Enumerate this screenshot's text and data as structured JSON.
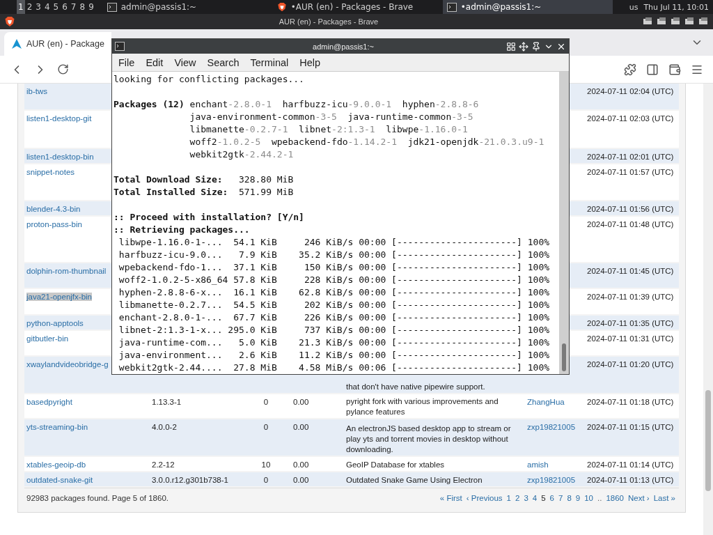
{
  "taskbar": {
    "workspaces": [
      {
        "label": "1",
        "selected": true
      },
      {
        "label": "2",
        "selected": false
      },
      {
        "label": "3",
        "selected": false
      },
      {
        "label": "4",
        "selected": false
      },
      {
        "label": "5",
        "selected": false
      },
      {
        "label": "6",
        "selected": false
      },
      {
        "label": "7",
        "selected": false
      },
      {
        "label": "8",
        "selected": false
      },
      {
        "label": "9",
        "selected": false
      }
    ],
    "windows": [
      {
        "kind": "terminal",
        "title": "admin@passis1:~",
        "selected": false
      },
      {
        "kind": "browser",
        "title": "•AUR (en) - Packages - Brave",
        "selected": false
      },
      {
        "kind": "terminal",
        "title": "•admin@passis1:~",
        "selected": true
      }
    ],
    "keyboard_layout": "us",
    "clock": "Thu Jul 11, 10:01"
  },
  "browser": {
    "window_title": "AUR (en) - Packages - Brave",
    "tab": {
      "title": "AUR (en) - Package"
    }
  },
  "packages_table": {
    "rows": [
      {
        "name": "ib-tws",
        "updated": "2024-07-11 02:04 (UTC)",
        "highlighted": false
      },
      {
        "name": "listen1-desktop-git",
        "updated": "2024-07-11 02:03 (UTC)",
        "highlighted": false
      },
      {
        "name": "listen1-desktop-bin",
        "updated": "2024-07-11 02:01 (UTC)",
        "highlighted": false
      },
      {
        "name": "snippet-notes",
        "updated": "2024-07-11 01:57 (UTC)",
        "highlighted": false
      },
      {
        "name": "blender-4.3-bin",
        "updated": "2024-07-11 01:56 (UTC)",
        "highlighted": false
      },
      {
        "name": "proton-pass-bin",
        "updated": "2024-07-11 01:48 (UTC)",
        "highlighted": false
      },
      {
        "name": "dolphin-rom-thumbnail",
        "updated": "2024-07-11 01:45 (UTC)",
        "highlighted": false
      },
      {
        "name": "java21-openjfx-bin",
        "updated": "2024-07-11 01:39 (UTC)",
        "highlighted": true
      },
      {
        "name": "python-apptools",
        "updated": "2024-07-11 01:35 (UTC)",
        "highlighted": false
      },
      {
        "name": "gitbutler-bin",
        "updated": "2024-07-11 01:31 (UTC)",
        "highlighted": false
      },
      {
        "name": "xwaylandvideobridge-g",
        "description": "that don't have native pipewire support.",
        "updated": "2024-07-11 01:20 (UTC)",
        "highlighted": false
      },
      {
        "name": "basedpyright",
        "version": "1.13.3-1",
        "votes": "0",
        "popularity": "0.00",
        "description": "pyright fork with various improvements and pylance features",
        "maintainer": "ZhangHua",
        "updated": "2024-07-11 01:18 (UTC)",
        "highlighted": false
      },
      {
        "name": "yts-streaming-bin",
        "version": "4.0.0-2",
        "votes": "0",
        "popularity": "0.00",
        "description": "An electronJS based desktop app to stream or play yts and torrent movies in desktop without downloading.",
        "maintainer": "zxp19821005",
        "updated": "2024-07-11 01:15 (UTC)",
        "highlighted": false
      },
      {
        "name": "xtables-geoip-db",
        "version": "2.2-12",
        "votes": "10",
        "popularity": "0.00",
        "description": "GeoIP Database for xtables",
        "maintainer": "amish",
        "updated": "2024-07-11 01:14 (UTC)",
        "highlighted": false
      },
      {
        "name": "outdated-snake-git",
        "version": "3.0.0.r12.g301b738-1",
        "votes": "0",
        "popularity": "0.00",
        "description": "Outdated Snake Game Using Electron",
        "maintainer": "zxp19821005",
        "updated": "2024-07-11 01:13 (UTC)",
        "highlighted": false
      }
    ]
  },
  "footer": {
    "summary": "92983 packages found. Page 5 of 1860.",
    "pagination": [
      {
        "label": "« First",
        "kind": "link",
        "selected": false
      },
      {
        "label": "‹ Previous",
        "kind": "link",
        "selected": false
      },
      {
        "label": "1",
        "kind": "link",
        "selected": false
      },
      {
        "label": "2",
        "kind": "link",
        "selected": false
      },
      {
        "label": "3",
        "kind": "link",
        "selected": false
      },
      {
        "label": "4",
        "kind": "link",
        "selected": false
      },
      {
        "label": "5",
        "kind": "link",
        "selected": true
      },
      {
        "label": "6",
        "kind": "link",
        "selected": false
      },
      {
        "label": "7",
        "kind": "link",
        "selected": false
      },
      {
        "label": "8",
        "kind": "link",
        "selected": false
      },
      {
        "label": "9",
        "kind": "link",
        "selected": false
      },
      {
        "label": "10",
        "kind": "link",
        "selected": false
      },
      {
        "label": "..",
        "kind": "ellipsis",
        "selected": false
      },
      {
        "label": "1860",
        "kind": "link",
        "selected": false
      },
      {
        "label": "Next ›",
        "kind": "link",
        "selected": false
      },
      {
        "label": "Last »",
        "kind": "link",
        "selected": false
      }
    ]
  },
  "terminal": {
    "title": "admin@passis1:~",
    "menu": [
      "File",
      "Edit",
      "View",
      "Search",
      "Terminal",
      "Help"
    ],
    "first_line": "looking for conflicting packages...",
    "packages_label": "Packages (12)",
    "package_lines": [
      [
        {
          "name": "enchant",
          "version": "-2.8.0-1"
        },
        {
          "name": "harfbuzz-icu",
          "version": "-9.0.0-1"
        },
        {
          "name": "hyphen",
          "version": "-2.8.8-6"
        }
      ],
      [
        {
          "name": "java-environment-common",
          "version": "-3-5"
        },
        {
          "name": "java-runtime-common",
          "version": "-3-5"
        }
      ],
      [
        {
          "name": "libmanette",
          "version": "-0.2.7-1"
        },
        {
          "name": "libnet",
          "version": "-2:1.3-1"
        },
        {
          "name": "libwpe",
          "version": "-1.16.0-1"
        }
      ],
      [
        {
          "name": "woff2",
          "version": "-1.0.2-5"
        },
        {
          "name": "wpebackend-fdo",
          "version": "-1.14.2-1"
        },
        {
          "name": "jdk21-openjdk",
          "version": "-21.0.3.u9-1"
        }
      ],
      [
        {
          "name": "webkit2gtk",
          "version": "-2.44.2-1"
        }
      ]
    ],
    "totals": [
      {
        "label": "Total Download Size:",
        "value": "328.80 MiB"
      },
      {
        "label": "Total Installed Size:",
        "value": "571.99 MiB"
      }
    ],
    "prompts": [
      ":: Proceed with installation? [Y/n]",
      ":: Retrieving packages..."
    ],
    "downloads": [
      {
        "name": "libwpe-1.16.0-1-...",
        "size": "54.1 KiB",
        "speed": "246 KiB/s",
        "time": "00:00",
        "bar": "[----------------------]",
        "percent": "100%"
      },
      {
        "name": "harfbuzz-icu-9.0...",
        "size": "7.9 KiB",
        "speed": "35.2 KiB/s",
        "time": "00:00",
        "bar": "[----------------------]",
        "percent": "100%"
      },
      {
        "name": "wpebackend-fdo-1...",
        "size": "37.1 KiB",
        "speed": "150 KiB/s",
        "time": "00:00",
        "bar": "[----------------------]",
        "percent": "100%"
      },
      {
        "name": "woff2-1.0.2-5-x86_64",
        "size": "57.8 KiB",
        "speed": "228 KiB/s",
        "time": "00:00",
        "bar": "[----------------------]",
        "percent": "100%"
      },
      {
        "name": "hyphen-2.8.8-6-x...",
        "size": "16.1 KiB",
        "speed": "62.8 KiB/s",
        "time": "00:00",
        "bar": "[----------------------]",
        "percent": "100%"
      },
      {
        "name": "libmanette-0.2.7...",
        "size": "54.5 KiB",
        "speed": "202 KiB/s",
        "time": "00:00",
        "bar": "[----------------------]",
        "percent": "100%"
      },
      {
        "name": "enchant-2.8.0-1-...",
        "size": "67.7 KiB",
        "speed": "226 KiB/s",
        "time": "00:00",
        "bar": "[----------------------]",
        "percent": "100%"
      },
      {
        "name": "libnet-2:1.3-1-x...",
        "size": "295.0 KiB",
        "speed": "737 KiB/s",
        "time": "00:00",
        "bar": "[----------------------]",
        "percent": "100%"
      },
      {
        "name": "java-runtime-com...",
        "size": "5.0 KiB",
        "speed": "21.3 KiB/s",
        "time": "00:00",
        "bar": "[----------------------]",
        "percent": "100%"
      },
      {
        "name": "java-environment...",
        "size": "2.6 KiB",
        "speed": "11.2 KiB/s",
        "time": "00:00",
        "bar": "[----------------------]",
        "percent": "100%"
      },
      {
        "name": "webkit2gtk-2.44....",
        "size": "27.8 MiB",
        "speed": "4.58 MiB/s",
        "time": "00:06",
        "bar": "[----------------------]",
        "percent": "100%"
      }
    ]
  }
}
